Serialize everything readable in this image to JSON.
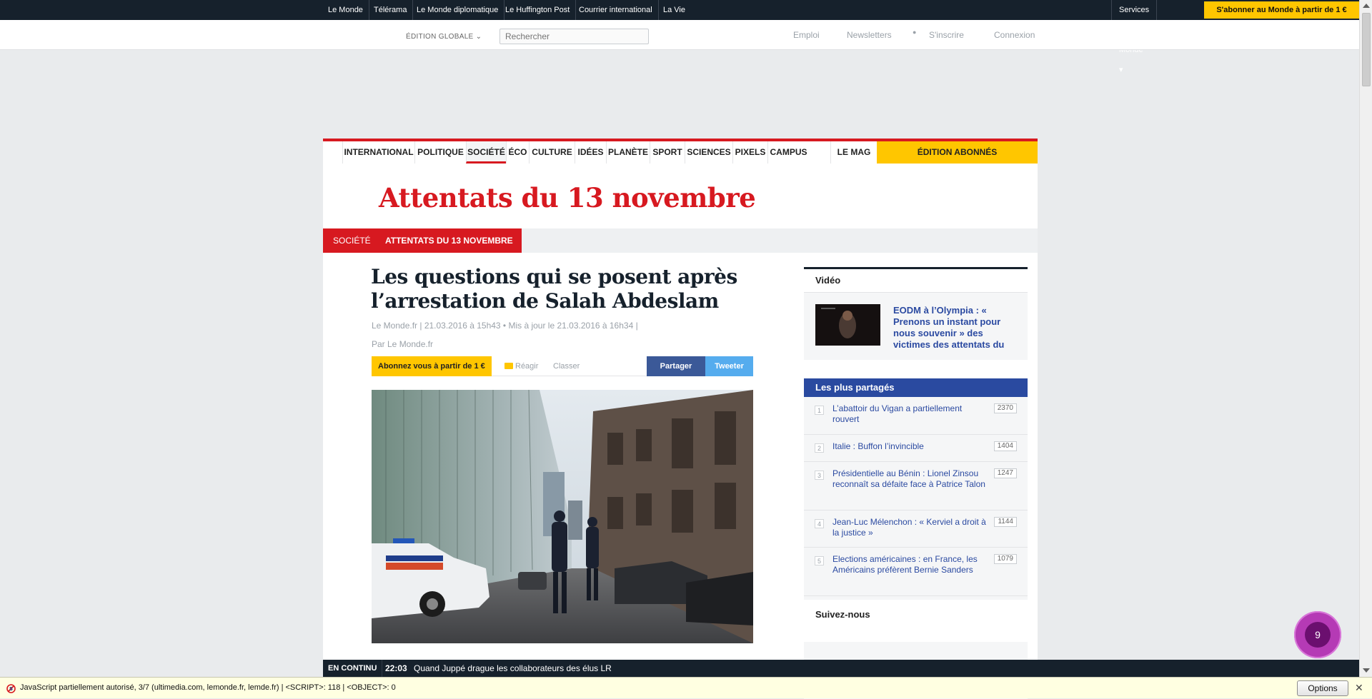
{
  "topbar": {
    "links": [
      "Le Monde",
      "Télérama",
      "Le Monde diplomatique",
      "Le Huffington Post",
      "Courrier international",
      "La Vie"
    ],
    "services": "Services Le Monde ▾",
    "subscribe": "S'abonner au Monde à partir de 1 €"
  },
  "header": {
    "edition": "ÉDITION GLOBALE ⌄",
    "search_placeholder": "Rechercher",
    "emploi": "Emploi",
    "newsletters": "Newsletters",
    "sinscrire": "S'inscrire",
    "connexion": "Connexion"
  },
  "nav": {
    "items": [
      "INTERNATIONAL",
      "POLITIQUE",
      "SOCIÉTÉ",
      "ÉCO",
      "CULTURE",
      "IDÉES",
      "PLANÈTE",
      "SPORT",
      "SCIENCES",
      "PIXELS",
      "CAMPUS",
      "LE MAG"
    ],
    "edition_abonnes": "ÉDITION ABONNÉS"
  },
  "dossier_title": "Attentats du 13 novembre",
  "breadcrumb": {
    "section": "SOCIÉTÉ",
    "topic": "ATTENTATS DU 13 NOVEMBRE"
  },
  "article": {
    "title": "Les questions qui se posent après l’arrestation de Salah Abdeslam",
    "meta": "Le Monde.fr | 21.03.2016 à 15h43 • Mis à jour le 21.03.2016 à 16h34 |",
    "author": "Par Le Monde.fr",
    "abonnez": "Abonnez vous à partir de 1 €",
    "reagir": "Réagir",
    "classer": "Classer",
    "partager": "Partager",
    "tweeter": "Tweeter"
  },
  "video": {
    "heading": "Vidéo",
    "title": "EODM à l’Olympia : « Prenons un instant pour nous souvenir » des victimes des attentats du"
  },
  "plus_partages": {
    "heading": "Les plus partagés",
    "items": [
      {
        "rank": "1",
        "text": "L’abattoir du Vigan a partiellement rouvert",
        "count": "2370"
      },
      {
        "rank": "2",
        "text": "Italie : Buffon l’invincible",
        "count": "1404"
      },
      {
        "rank": "3",
        "text": "Présidentielle au Bénin : Lionel Zinsou reconnaît sa défaite face à Patrice Talon",
        "count": "1247"
      },
      {
        "rank": "4",
        "text": "Jean-Luc Mélenchon : « Kerviel a droit à la justice »",
        "count": "1144"
      },
      {
        "rank": "5",
        "text": "Elections américaines : en France, les Américains préfèrent Bernie Sanders",
        "count": "1079"
      }
    ]
  },
  "suivez": "Suivez-nous",
  "en_continu": {
    "label": "EN CONTINU",
    "time": "22:03",
    "text": "Quand Juppé drague les collaborateurs des élus LR"
  },
  "notification_count": "9",
  "noscript": {
    "message": "JavaScript partiellement autorisé, 3/7 (ultimedia.com, lemonde.fr, lemde.fr) | <SCRIPT>: 118 | <OBJECT>: 0",
    "options": "Options",
    "close": "✕"
  },
  "colors": {
    "lemonde_red": "#d71920",
    "dark": "#16212c",
    "yellow": "#ffc600",
    "facebook": "#3b5998",
    "twitter": "#55acee",
    "link_blue": "#2b4aa1"
  }
}
